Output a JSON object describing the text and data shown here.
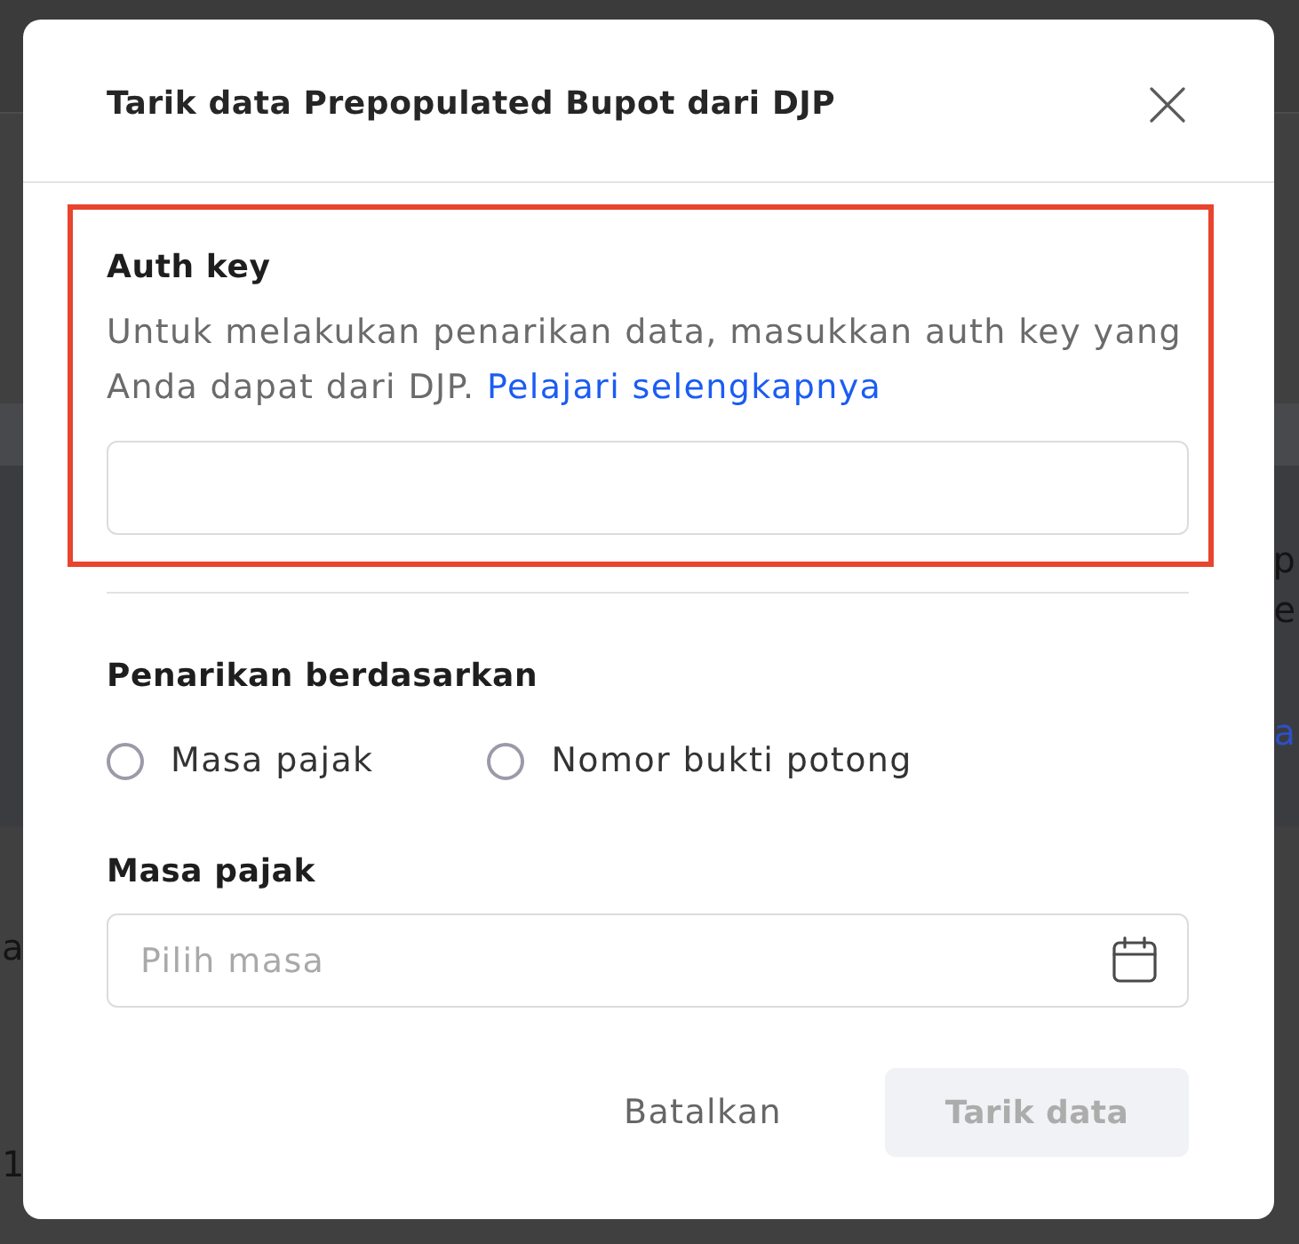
{
  "backdrop": {
    "right_edge": [
      {
        "text": "p",
        "kind": "text"
      },
      {
        "text": "e",
        "kind": "text"
      },
      {
        "text": "a",
        "kind": "link"
      }
    ],
    "left_edge": [
      {
        "text": "a",
        "kind": "text"
      },
      {
        "text": "1",
        "kind": "text"
      }
    ]
  },
  "dialog": {
    "title": "Tarik data Prepopulated Bupot dari DJP"
  },
  "auth_key": {
    "highlighted": true,
    "label": "Auth key",
    "description": "Untuk melakukan penarikan data, masukkan auth key yang Anda dapat dari DJP.",
    "link": "Pelajari selengkapnya"
  },
  "pull_by": {
    "label": "Penarikan berdasarkan",
    "options": [
      {
        "label": "Masa pajak",
        "selected": false
      },
      {
        "label": "Nomor bukti potong",
        "selected": false
      }
    ]
  },
  "tax_period": {
    "label": "Masa pajak",
    "placeholder": "Pilih masa"
  },
  "buttons": [
    {
      "label": "Batalkan",
      "kind": "text",
      "disabled": false
    },
    {
      "label": "Tarik data",
      "kind": "primary",
      "disabled": true
    }
  ]
}
